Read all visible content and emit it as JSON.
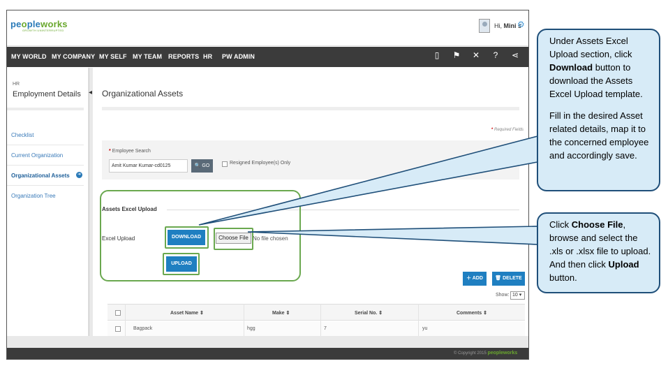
{
  "header": {
    "logo_part1": "pe",
    "logo_part2": "o",
    "logo_part3": "ple",
    "logo_part4": "w",
    "logo_part5": "o",
    "logo_part6": "rks",
    "tagline": "GROWTH UNINTERRUPTED",
    "greeting_prefix": "Hi, ",
    "user_name": "Mini s"
  },
  "nav": {
    "items": [
      "MY WORLD",
      "MY COMPANY",
      "MY SELF",
      "MY TEAM",
      "REPORTS",
      "HR",
      "PW ADMIN"
    ],
    "icons": [
      "book-icon",
      "flag-icon",
      "tools-icon",
      "help-icon",
      "share-icon"
    ]
  },
  "sidebar": {
    "module": "HR",
    "title": "Employment Details",
    "items": [
      "Checklist",
      "Current Organization",
      "Organizational Assets",
      "Organization Tree"
    ],
    "active_item": "Organizational Assets"
  },
  "main": {
    "page_title": "Organizational Assets",
    "required_marker": "*",
    "required_text": " Required Fields",
    "employee_search_label": "Employee Search",
    "employee_search_value": "Amit Kumar Kumar-cd0125",
    "go_label": "GO",
    "resigned_label": "Resigned Employee(s) Only",
    "assets_section_title": "Assets Excel Upload",
    "excel_upload_label": "Excel Upload",
    "download_label": "DOWNLOAD",
    "choose_file_label": "Choose File",
    "no_file_text": "No file chosen",
    "upload_label": "UPLOAD",
    "add_label": "ADD",
    "delete_label": "DELETE",
    "show_label": "Show:",
    "show_value": "10",
    "table": {
      "headers": [
        "Asset Name",
        "Make",
        "Serial No.",
        "Comments"
      ],
      "rows": [
        [
          "Bagpack",
          "hgg",
          "7",
          "yu"
        ]
      ]
    }
  },
  "footer": {
    "copyright": "© Copyright 2015",
    "brand": "peopleworks"
  },
  "callouts": {
    "c1_p1_a": "Under Assets Excel Upload section, click ",
    "c1_p1_b": "Download",
    "c1_p1_c": " button to download the Assets Excel Upload template.",
    "c1_p2": "Fill in the desired Asset related details, map it to the concerned employee and accordingly save.",
    "c2_a": "Click ",
    "c2_b": "Choose File",
    "c2_c": ", browse and select the .xls or .xlsx file to upload. And then click ",
    "c2_d": "Upload",
    "c2_e": " button."
  },
  "colors": {
    "nav_bg": "#3b3b3b",
    "primary_blue": "#1f7fc1",
    "highlight_green": "#6aa84f",
    "callout_fill": "#d7ebf7",
    "callout_border": "#1f4f79"
  }
}
